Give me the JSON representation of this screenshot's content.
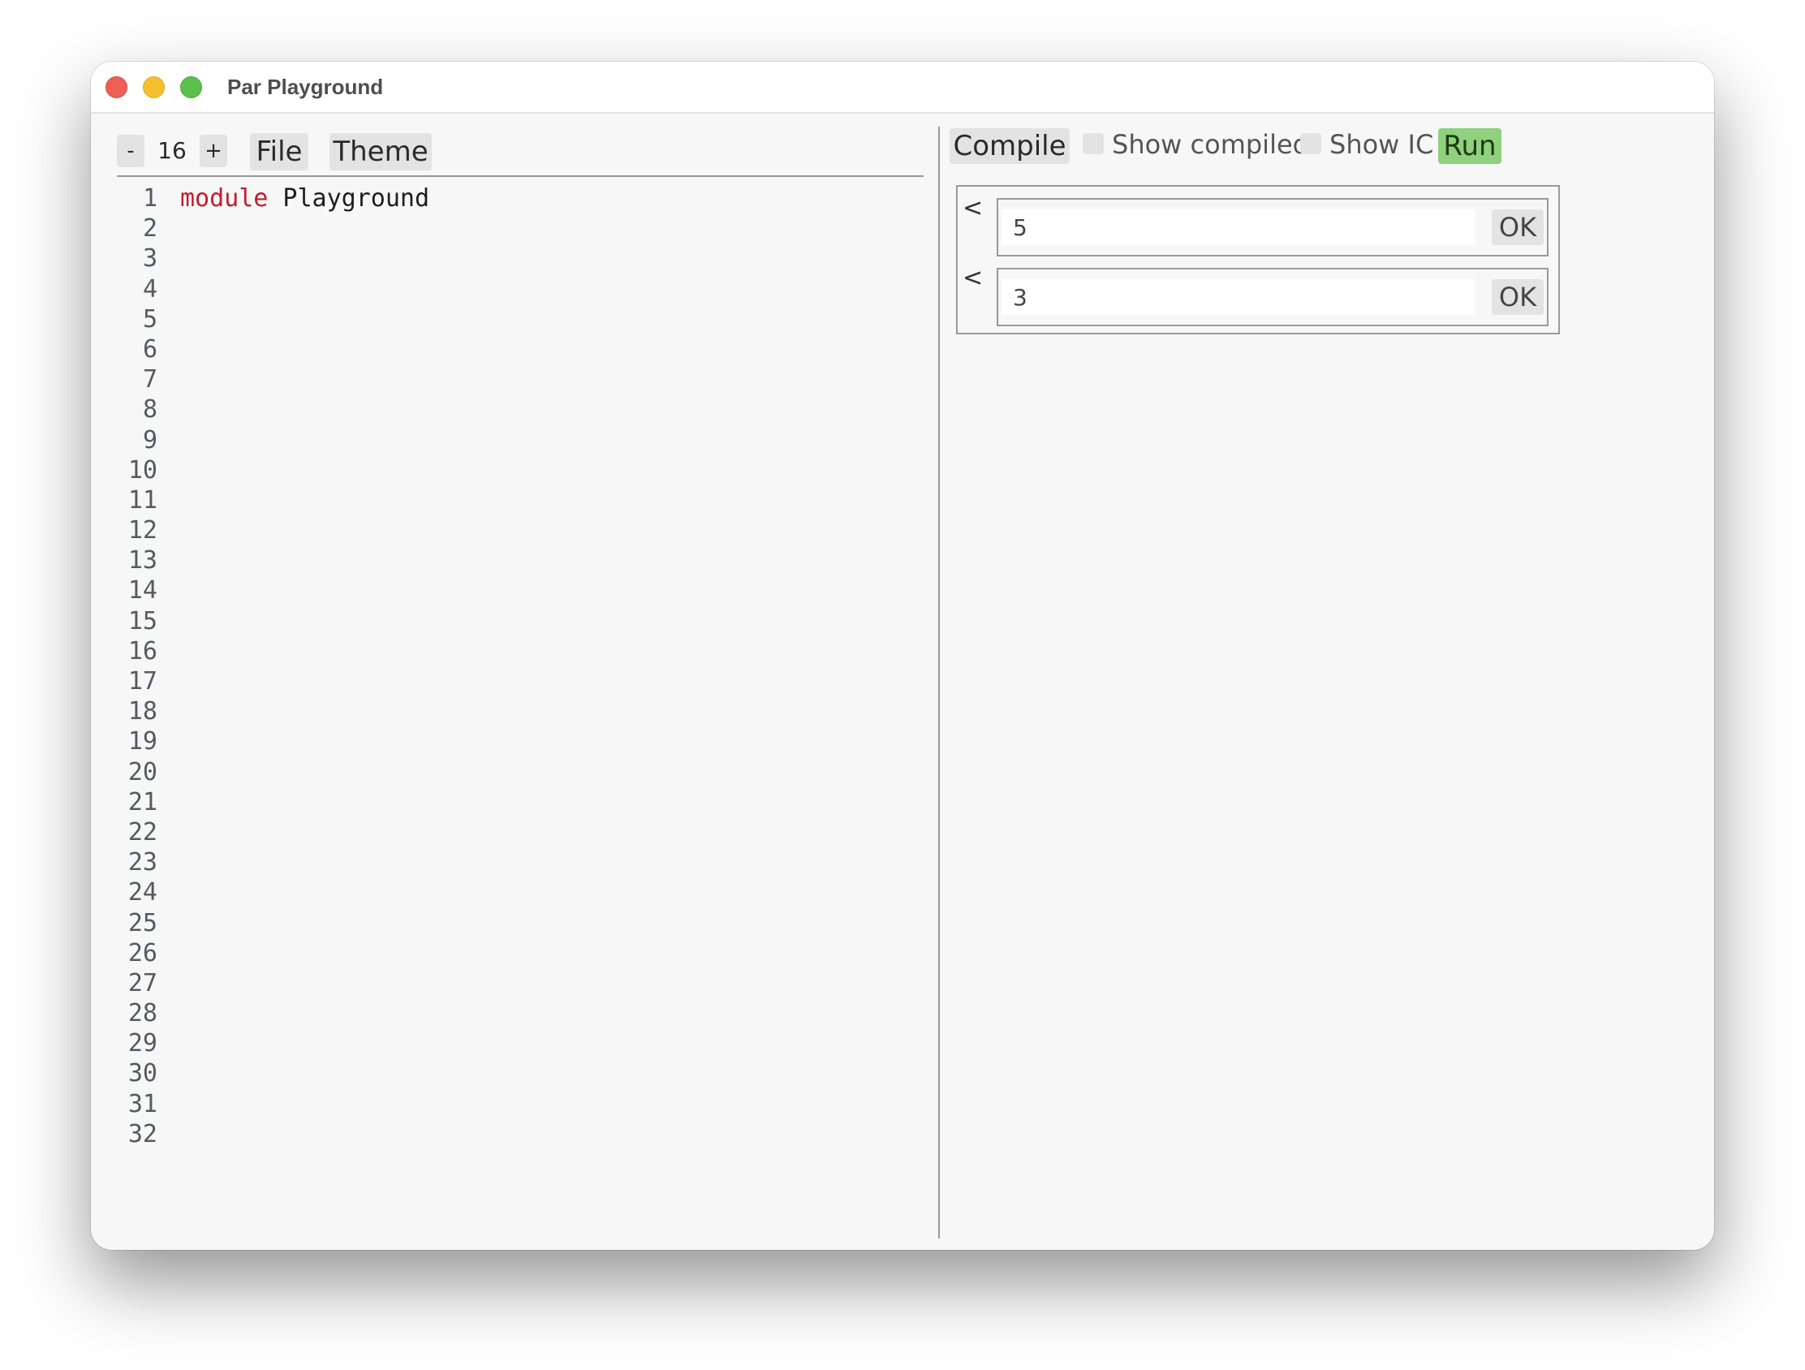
{
  "window": {
    "title": "Par Playground"
  },
  "toolbar": {
    "decrease_label": "-",
    "font_size": "16",
    "increase_label": "+",
    "file_label": "File",
    "theme_label": "Theme"
  },
  "editor": {
    "line_numbers": [
      "1",
      "2",
      "3",
      "4",
      "5",
      "6",
      "7",
      "8",
      "9",
      "10",
      "11",
      "12",
      "13",
      "14",
      "15",
      "16",
      "17",
      "18",
      "19",
      "20",
      "21",
      "22",
      "23",
      "24",
      "25",
      "26",
      "27",
      "28",
      "29",
      "30",
      "31",
      "32"
    ],
    "line1_keyword": "module",
    "line1_rest": " Playground"
  },
  "run_toolbar": {
    "compile_label": "Compile",
    "show_compiled_label": "Show compiled",
    "show_ic_label": "Show IC",
    "run_label": "Run"
  },
  "io": {
    "prompt_symbol": "<",
    "inputs": [
      {
        "value": "5",
        "ok_label": "OK"
      },
      {
        "value": "3",
        "ok_label": "OK"
      }
    ]
  },
  "colors": {
    "keyword": "#c01d2c",
    "run_button": "#8fd17d",
    "close": "#ee5f57",
    "minimize": "#f5c02e",
    "maximize": "#5ac14b"
  }
}
